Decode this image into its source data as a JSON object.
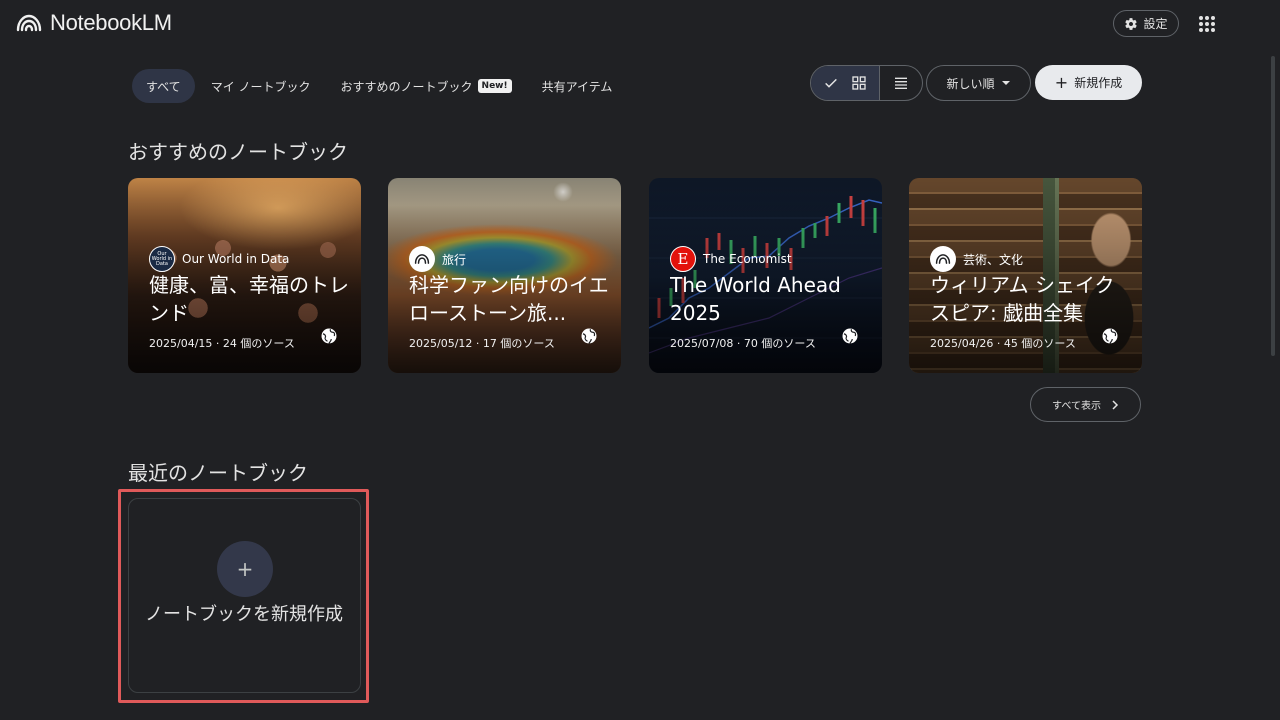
{
  "app": {
    "title": "NotebookLM",
    "settings_label": "設定"
  },
  "tabs": [
    {
      "label": "すべて",
      "active": true
    },
    {
      "label": "マイ ノートブック",
      "active": false
    },
    {
      "label": "おすすめのノートブック",
      "active": false,
      "badge": "New!"
    },
    {
      "label": "共有アイテム",
      "active": false
    }
  ],
  "toolbar": {
    "sort_label": "新しい順",
    "create_label": "新規作成",
    "view_mode": "grid"
  },
  "featured": {
    "title": "おすすめのノートブック",
    "show_all_label": "すべて表示",
    "cards": [
      {
        "source": "Our World in Data",
        "source_icon_text": "Our World in Data",
        "title": "健康、富、幸福のトレンド",
        "meta": "2025/04/15 · 24 個のソース"
      },
      {
        "source": "旅行",
        "title": "科学ファン向けのイエローストーン旅...",
        "meta": "2025/05/12 · 17 個のソース"
      },
      {
        "source": "The Economist",
        "source_icon_text": "E",
        "title": "The World Ahead 2025",
        "meta": "2025/07/08 · 70 個のソース"
      },
      {
        "source": "芸術、文化",
        "title": "ウィリアム シェイクスピア: 戯曲全集",
        "meta": "2025/04/26 · 45 個のソース"
      }
    ]
  },
  "recent": {
    "title": "最近のノートブック",
    "new_notebook_label": "ノートブックを新規作成"
  },
  "colors": {
    "background": "#202124",
    "highlight": "#e05a5a",
    "economist_red": "#e3120b"
  }
}
